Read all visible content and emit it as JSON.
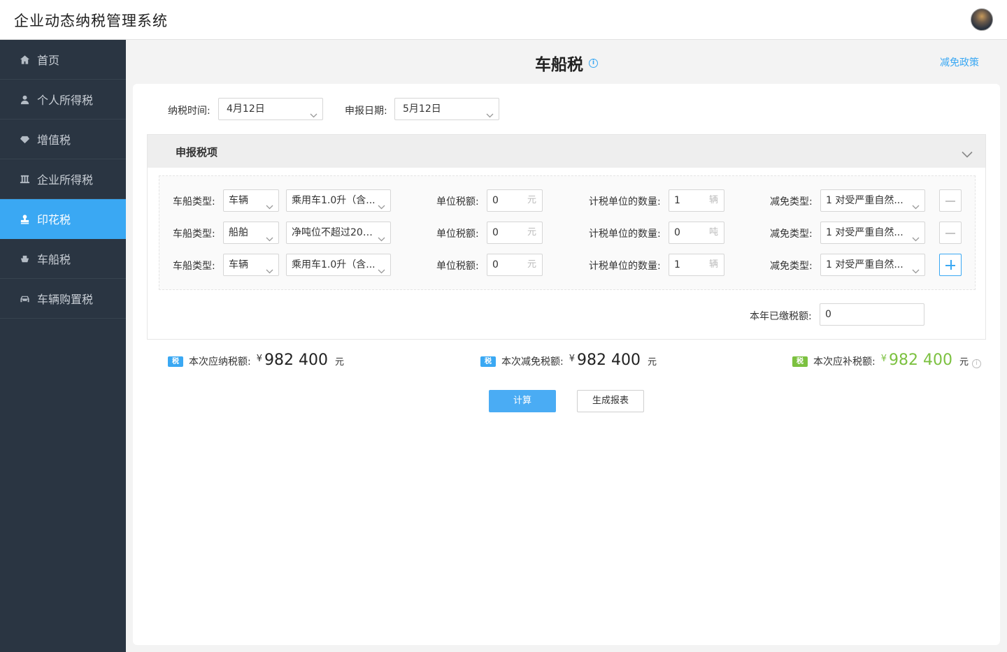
{
  "header": {
    "app_title": "企业动态纳税管理系统"
  },
  "sidebar": {
    "items": [
      {
        "label": "首页",
        "icon": "home-icon",
        "active": false
      },
      {
        "label": "个人所得税",
        "icon": "person-icon",
        "active": false
      },
      {
        "label": "增值税",
        "icon": "diamond-icon",
        "active": false
      },
      {
        "label": "企业所得税",
        "icon": "building-icon",
        "active": false
      },
      {
        "label": "印花税",
        "icon": "stamp-icon",
        "active": true
      },
      {
        "label": "车船税",
        "icon": "boat-icon",
        "active": false
      },
      {
        "label": "车辆购置税",
        "icon": "car-icon",
        "active": false
      }
    ]
  },
  "page": {
    "title": "车船税",
    "info_glyph": "i",
    "policy_link": "减免政策"
  },
  "filters": {
    "tax_time_label": "纳税时间:",
    "tax_time_value": "4月12日",
    "declare_date_label": "申报日期:",
    "declare_date_value": "5月12日"
  },
  "section": {
    "title": "申报税项"
  },
  "rows": [
    {
      "type_label": "车船类型:",
      "type_value": "车辆",
      "subtype_value": "乘用车1.0升（含...",
      "unit_tax_label": "单位税额:",
      "unit_tax_value": "0",
      "unit_tax_unit": "元",
      "qty_label": "计税单位的数量:",
      "qty_value": "1",
      "qty_unit": "辆",
      "relief_label": "减免类型:",
      "relief_value": "1 对受严重自然...",
      "action": "minus"
    },
    {
      "type_label": "车船类型:",
      "type_value": "船舶",
      "subtype_value": "净吨位不超过200...",
      "unit_tax_label": "单位税额:",
      "unit_tax_value": "0",
      "unit_tax_unit": "元",
      "qty_label": "计税单位的数量:",
      "qty_value": "0",
      "qty_unit": "吨",
      "relief_label": "减免类型:",
      "relief_value": "1 对受严重自然...",
      "action": "minus"
    },
    {
      "type_label": "车船类型:",
      "type_value": "车辆",
      "subtype_value": "乘用车1.0升（含...",
      "unit_tax_label": "单位税额:",
      "unit_tax_value": "0",
      "unit_tax_unit": "元",
      "qty_label": "计税单位的数量:",
      "qty_value": "1",
      "qty_unit": "辆",
      "relief_label": "减免类型:",
      "relief_value": "1 对受严重自然...",
      "action": "plus"
    }
  ],
  "paid": {
    "label": "本年已缴税额:",
    "value": "0"
  },
  "summary": {
    "badge": "税",
    "payable_label": "本次应纳税额:",
    "payable_amount": "982 400",
    "relief_label": "本次减免税额:",
    "relief_amount": "982 400",
    "supplement_label": "本次应补税额:",
    "supplement_amount": "982 400",
    "currency": "¥",
    "unit": "元",
    "info_glyph": "i",
    "supplement_color": "#7cc140"
  },
  "buttons": {
    "calculate": "计算",
    "report": "生成报表"
  },
  "colors": {
    "accent": "#3aa8f3",
    "sidebar_bg": "#2a3542",
    "success": "#7cc140"
  }
}
